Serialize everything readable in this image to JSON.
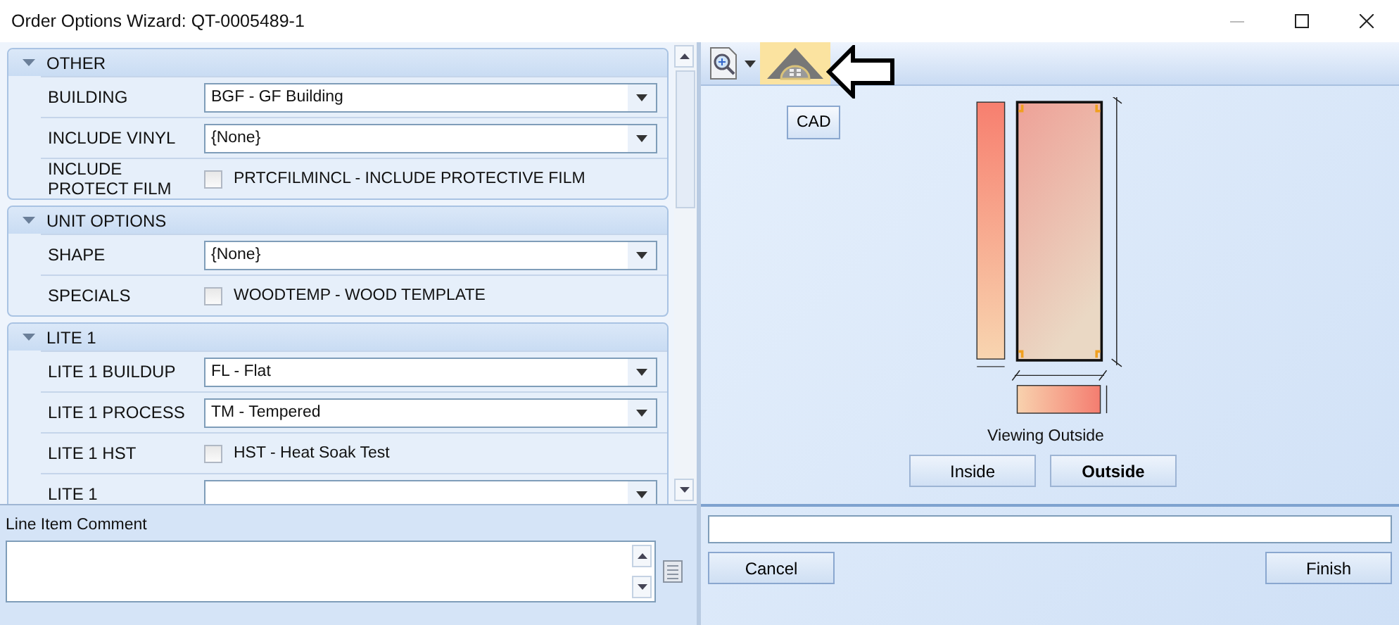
{
  "window": {
    "title": "Order Options Wizard: QT-0005489-1"
  },
  "sections": [
    {
      "title": "OTHER",
      "expanded": true,
      "rows": [
        {
          "kind": "dropdown",
          "label": "BUILDING",
          "value": "BGF - GF Building"
        },
        {
          "kind": "dropdown",
          "label": "INCLUDE VINYL",
          "value": "{None}"
        },
        {
          "kind": "checkbox",
          "label": "INCLUDE PROTECT FILM",
          "text": "PRTCFILMINCL - INCLUDE PROTECTIVE FILM",
          "checked": false
        }
      ]
    },
    {
      "title": "UNIT OPTIONS",
      "expanded": true,
      "rows": [
        {
          "kind": "dropdown",
          "label": "SHAPE",
          "value": "{None}"
        },
        {
          "kind": "checkbox",
          "label": "SPECIALS",
          "text": "WOODTEMP - WOOD TEMPLATE",
          "checked": false
        }
      ]
    },
    {
      "title": "LITE 1",
      "expanded": true,
      "rows": [
        {
          "kind": "dropdown",
          "label": "LITE 1 BUILDUP",
          "value": "FL - Flat"
        },
        {
          "kind": "dropdown",
          "label": "LITE 1 PROCESS",
          "value": "TM - Tempered"
        },
        {
          "kind": "checkbox",
          "label": "LITE 1 HST",
          "text": "HST - Heat Soak Test",
          "checked": false
        },
        {
          "kind": "dropdown",
          "label": "LITE 1"
        }
      ]
    }
  ],
  "comment": {
    "label": "Line Item Comment"
  },
  "preview": {
    "cad_button": "CAD",
    "caption": "Viewing Outside",
    "views": [
      {
        "label": "Inside",
        "selected": false
      },
      {
        "label": "Outside",
        "selected": true
      }
    ]
  },
  "buttons": [
    "Cancel",
    "Finish"
  ]
}
